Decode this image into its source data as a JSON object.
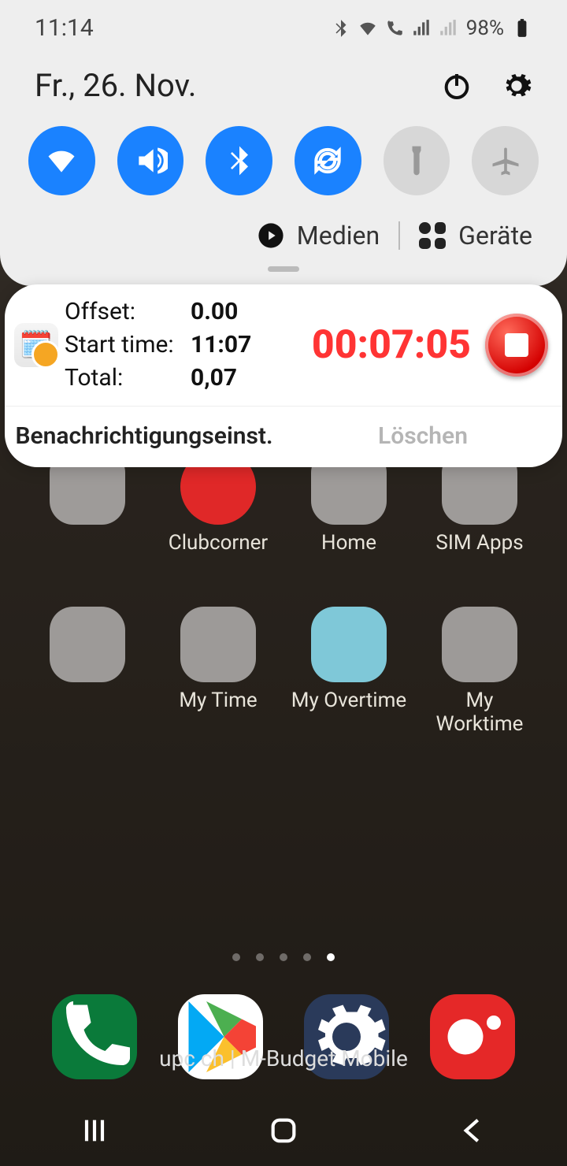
{
  "status": {
    "time": "11:14",
    "battery_pct": "98%"
  },
  "qs": {
    "date": "Fr., 26. Nov.",
    "media_label": "Medien",
    "devices_label": "Geräte"
  },
  "notification": {
    "offset_label": "Offset:",
    "offset_value": "0.00",
    "start_label": "Start time:",
    "start_value": "11:07",
    "total_label": "Total:",
    "total_value": "0,07",
    "elapsed": "00:07:05",
    "action_settings": "Benachrichtigungseinst.",
    "action_clear": "Löschen"
  },
  "home": {
    "apps_row1": [
      "",
      "Clubcorner",
      "Home",
      "SIM Apps"
    ],
    "apps_row2": [
      "",
      "My Time",
      "My Overtime",
      "My Worktime"
    ],
    "carrier": "upc ch | M-Budget Mobile"
  }
}
